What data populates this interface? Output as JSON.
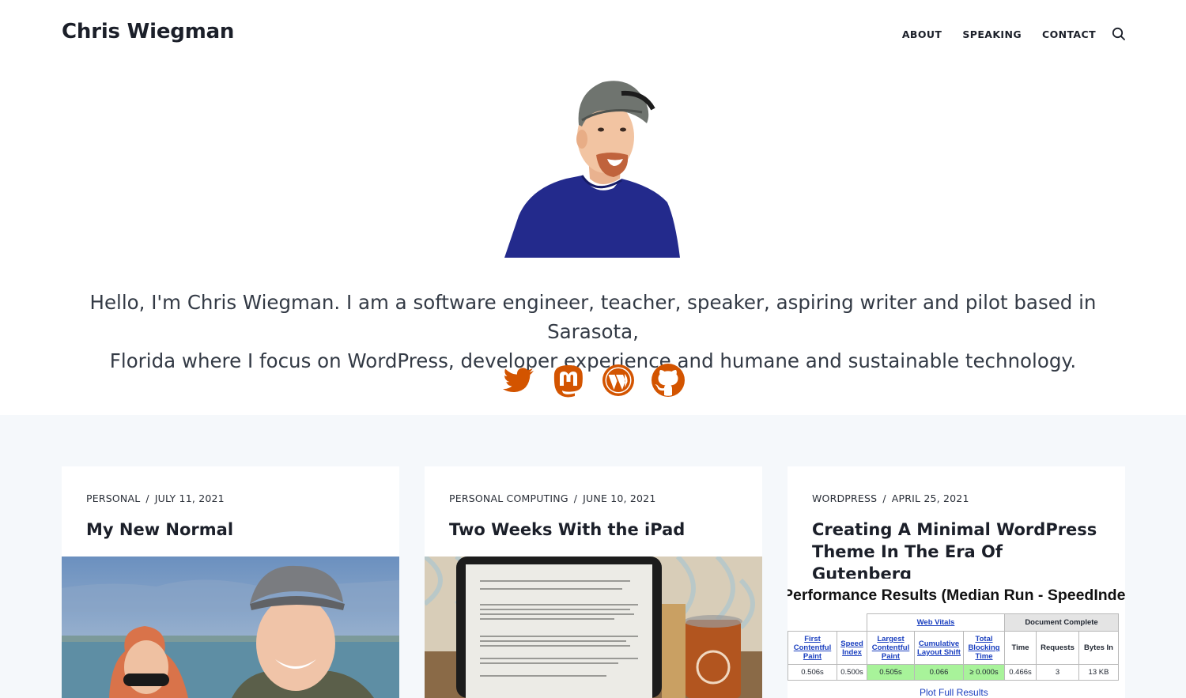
{
  "site": {
    "title": "Chris Wiegman"
  },
  "nav": {
    "items": [
      "ABOUT",
      "SPEAKING",
      "CONTACT"
    ],
    "search_icon": "search-icon"
  },
  "hero": {
    "intro_line1": "Hello, I'm Chris Wiegman. I am a software engineer, teacher, speaker, aspiring writer and pilot based in Sarasota,",
    "intro_line2": "Florida where I focus on WordPress, developer experience and humane and sustainable technology.",
    "socials": [
      "twitter-icon",
      "mastodon-icon",
      "wordpress-icon",
      "github-icon"
    ],
    "accent": "#d35400"
  },
  "posts": [
    {
      "category": "PERSONAL",
      "date": "JULY 11, 2021",
      "title": "My New Normal"
    },
    {
      "category": "PERSONAL COMPUTING",
      "date": "JUNE 10, 2021",
      "title": "Two Weeks With the iPad"
    },
    {
      "category": "WORDPRESS",
      "date": "APRIL 25, 2021",
      "title": "Creating A Minimal WordPress Theme In The Era Of Gutenberg"
    }
  ],
  "perf": {
    "title": "Performance Results (Median Run - SpeedIndex",
    "group_web_vitals": "Web Vitals",
    "group_doc": "Document Complete",
    "headers": [
      "First Contentful Paint",
      "Speed Index",
      "Largest Contentful Paint",
      "Cumulative Layout Shift",
      "Total Blocking Time",
      "Time",
      "Requests",
      "Bytes In"
    ],
    "values": [
      "0.506s",
      "0.500s",
      "0.505s",
      "0.066",
      "≥ 0.000s",
      "0.466s",
      "3",
      "13 KB"
    ],
    "footer": "Plot Full Results"
  }
}
